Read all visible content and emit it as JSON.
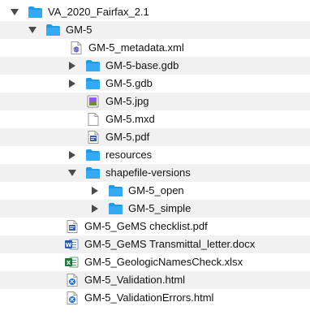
{
  "tree": [
    {
      "label": "VA_2020_Fairfax_2.1",
      "icon": "folder-icon",
      "disclosure": "expanded"
    },
    {
      "label": "GM-5",
      "icon": "folder-icon",
      "disclosure": "expanded"
    },
    {
      "label": "GM-5_metadata.xml",
      "icon": "xml-file-icon",
      "disclosure": "none"
    },
    {
      "label": "GM-5-base.gdb",
      "icon": "folder-icon",
      "disclosure": "collapsed"
    },
    {
      "label": "GM-5.gdb",
      "icon": "folder-icon",
      "disclosure": "collapsed"
    },
    {
      "label": "GM-5.jpg",
      "icon": "image-file-icon",
      "disclosure": "none"
    },
    {
      "label": "GM-5.mxd",
      "icon": "blank-file-icon",
      "disclosure": "none"
    },
    {
      "label": "GM-5.pdf",
      "icon": "pdf-file-icon",
      "disclosure": "none"
    },
    {
      "label": "resources",
      "icon": "folder-icon",
      "disclosure": "collapsed"
    },
    {
      "label": "shapefile-versions",
      "icon": "folder-icon",
      "disclosure": "expanded"
    },
    {
      "label": "GM-5_open",
      "icon": "folder-icon",
      "disclosure": "collapsed"
    },
    {
      "label": "GM-5_simple",
      "icon": "folder-icon",
      "disclosure": "collapsed"
    },
    {
      "label": "GM-5_GeMS checklist.pdf",
      "icon": "pdf-file-icon",
      "disclosure": "none"
    },
    {
      "label": "GM-5_GeMS Transmittal_letter.docx",
      "icon": "word-file-icon",
      "disclosure": "none"
    },
    {
      "label": "GM-5_GeologicNamesCheck.xlsx",
      "icon": "excel-file-icon",
      "disclosure": "none"
    },
    {
      "label": "GM-5_Validation.html",
      "icon": "html-file-icon",
      "disclosure": "none"
    },
    {
      "label": "GM-5_ValidationErrors.html",
      "icon": "html-file-icon",
      "disclosure": "none"
    }
  ]
}
